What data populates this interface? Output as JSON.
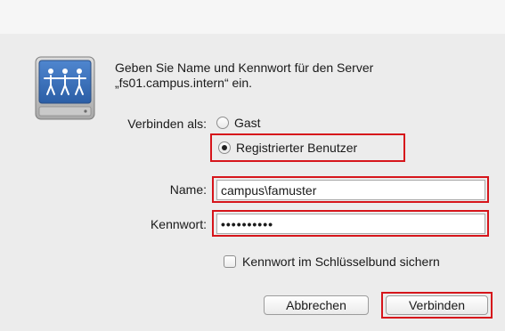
{
  "dialog": {
    "prompt_line1": "Geben Sie Name und Kennwort für den Server",
    "prompt_line2": "„fs01.campus.intern“ ein.",
    "connect_as_label": "Verbinden als:",
    "options": {
      "guest_label": "Gast",
      "registered_label": "Registrierter Benutzer",
      "selected": "registered"
    },
    "name_label": "Name:",
    "name_value": "campus\\famuster",
    "password_label": "Kennwort:",
    "password_mask": "••••••••••",
    "keychain_label": "Kennwort im Schlüsselbund sichern",
    "keychain_checked": false,
    "cancel_label": "Abbrechen",
    "connect_label": "Verbinden"
  },
  "colors": {
    "highlight": "#d6151b",
    "background": "#ececec",
    "icon_blue": "#3b6fb5"
  },
  "icons": {
    "server": "network-server-icon"
  }
}
